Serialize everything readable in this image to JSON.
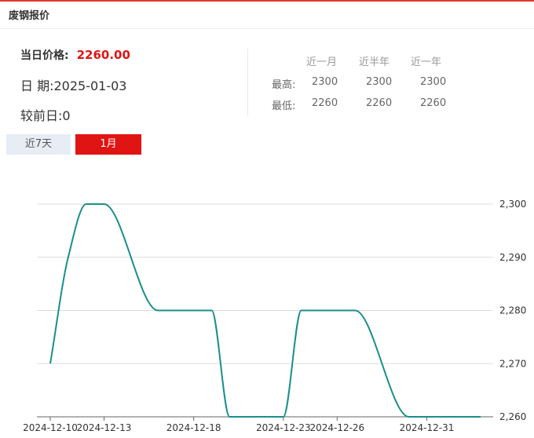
{
  "panel": {
    "title": "废钢报价"
  },
  "summary": {
    "price_label": "当日价格:",
    "price_value": "2260.00",
    "date_label": "日 期:",
    "date_value": "2025-01-03",
    "change_label": "较前日:",
    "change_value": "0"
  },
  "stats": {
    "headers": [
      "近一月",
      "近半年",
      "近一年"
    ],
    "rows": [
      {
        "label": "最高:",
        "values": [
          "2300",
          "2300",
          "2300"
        ]
      },
      {
        "label": "最低:",
        "values": [
          "2260",
          "2260",
          "2260"
        ]
      }
    ]
  },
  "tabs": [
    {
      "label": "近7天",
      "active": false
    },
    {
      "label": "1月",
      "active": true
    }
  ],
  "colors": {
    "accent": "#e11414",
    "line": "#1a8f8c",
    "grid": "#dddddd"
  },
  "chart_data": {
    "type": "line",
    "x": [
      "2024-12-10",
      "2024-12-11",
      "2024-12-12",
      "2024-12-13",
      "2024-12-16",
      "2024-12-17",
      "2024-12-18",
      "2024-12-19",
      "2024-12-20",
      "2024-12-23",
      "2024-12-24",
      "2024-12-25",
      "2024-12-26",
      "2024-12-27",
      "2024-12-30",
      "2024-12-31",
      "2025-01-02",
      "2025-01-03"
    ],
    "series": [
      {
        "values": [
          2270,
          2290,
          2300,
          2300,
          2280,
          2280,
          2280,
          2280,
          2260,
          2260,
          2280,
          2280,
          2280,
          2280,
          2260,
          2260,
          2260,
          2260
        ]
      }
    ],
    "xticks": [
      "2024-12-10",
      "2024-12-13",
      "2024-12-18",
      "2024-12-23",
      "2024-12-26",
      "2024-12-31"
    ],
    "yticks": [
      "2,300",
      "2,290",
      "2,280",
      "2,270",
      "2,260"
    ],
    "ylim": [
      2260,
      2300
    ],
    "grid": true,
    "xlabel": "",
    "ylabel": ""
  }
}
